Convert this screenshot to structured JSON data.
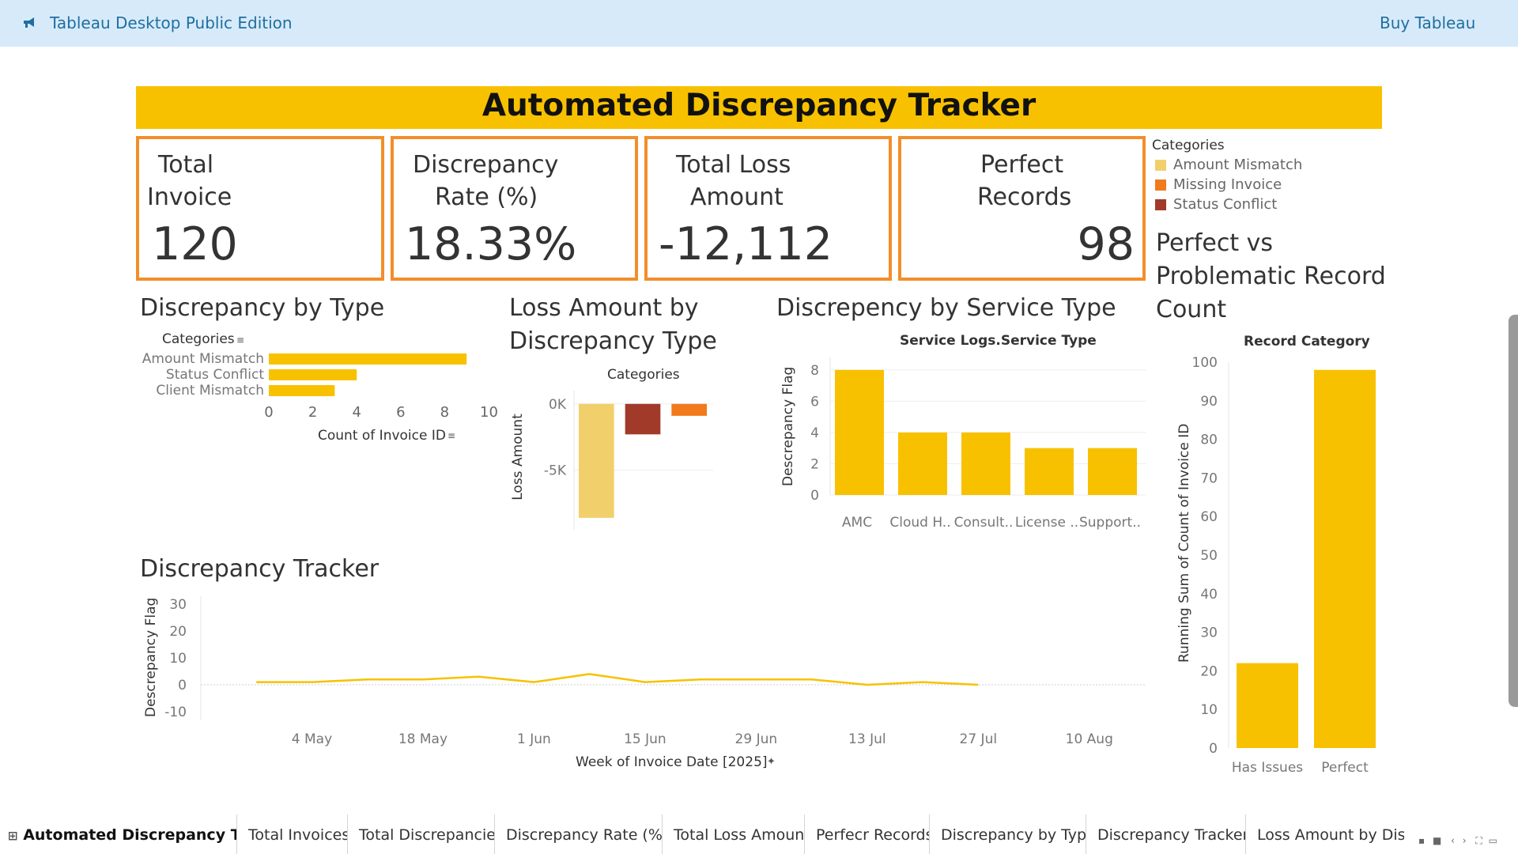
{
  "app": {
    "title": "Tableau Desktop Public Edition",
    "buy_label": "Buy Tableau"
  },
  "dashboard": {
    "title": "Automated Discrepancy Tracker",
    "accent_color": "#f8c100",
    "kpi_border_color": "#f28e2b"
  },
  "kpis": {
    "total_invoice": {
      "label_line1": "Total",
      "label_line2": "Invoice",
      "value": "120"
    },
    "discrepancy_rate": {
      "label_line1": "Discrepancy",
      "label_line2": "Rate (%)",
      "value": "18.33%"
    },
    "total_loss": {
      "label_line1": "Total Loss",
      "label_line2": "Amount",
      "value": "-12,112"
    },
    "perfect_records": {
      "label_line1": "Perfect",
      "label_line2": "Records",
      "value": "98"
    }
  },
  "legend": {
    "title": "Categories",
    "items": [
      {
        "label": "Amount Mismatch",
        "color": "#f1d06b"
      },
      {
        "label": "Missing Invoice",
        "color": "#f07a1c"
      },
      {
        "label": "Status Conflict",
        "color": "#a23a2a"
      }
    ]
  },
  "headings": {
    "by_type": "Discrepancy by Type",
    "loss_line1": "Loss Amount by",
    "loss_line2": "Discrepancy Type",
    "service": "Discrepency by Service Type",
    "tracker": "Discrepancy Tracker",
    "perfect_line1": "Perfect vs",
    "perfect_line2": "Problematic Record",
    "perfect_line3": "Count"
  },
  "chart_data": [
    {
      "type": "bar",
      "orientation": "horizontal",
      "row_header": "Categories",
      "categories": [
        "Amount Mismatch",
        "Status Conflict",
        "Client Mismatch"
      ],
      "values": [
        9,
        4,
        3
      ],
      "xlabel": "Count of Invoice ID",
      "xlim": [
        0,
        10
      ],
      "xticks": [
        "0",
        "2",
        "4",
        "6",
        "8",
        "10"
      ],
      "color": "#f8c100"
    },
    {
      "type": "bar",
      "column_header": "Categories",
      "categories": [
        "Amo..",
        "Statu..",
        "Missi.."
      ],
      "values": [
        -8600,
        -2300,
        -900
      ],
      "colors": [
        "#f1d06b",
        "#a23a2a",
        "#f07a1c"
      ],
      "ylabel": "Loss Amount",
      "ylim": [
        -9500,
        1000
      ],
      "yticks": [
        {
          "v": 0,
          "label": "0K"
        },
        {
          "v": -5000,
          "label": "-5K"
        }
      ]
    },
    {
      "type": "bar",
      "column_header": "Service Logs.Service Type",
      "categories": [
        "AMC",
        "Cloud H..",
        "Consult..",
        "License ..",
        "Support.."
      ],
      "values": [
        8,
        4,
        4,
        3,
        3
      ],
      "ylabel": "Descrepancy Flag",
      "ylim": [
        0,
        8.8
      ],
      "yticks": [
        0,
        2,
        4,
        6,
        8
      ],
      "color": "#f8c100"
    },
    {
      "type": "line",
      "x": [
        "2025-04-27",
        "2025-05-04",
        "2025-05-11",
        "2025-05-18",
        "2025-05-25",
        "2025-06-01",
        "2025-06-08",
        "2025-06-15",
        "2025-06-22",
        "2025-06-29",
        "2025-07-06",
        "2025-07-13",
        "2025-07-20",
        "2025-07-27"
      ],
      "y": [
        1,
        1,
        2,
        2,
        3,
        1,
        4,
        1,
        2,
        2,
        2,
        0,
        1,
        0
      ],
      "xticks": [
        "4 May",
        "18 May",
        "1 Jun",
        "15 Jun",
        "29 Jun",
        "13 Jul",
        "27 Jul",
        "10 Aug"
      ],
      "xlabel": "Week of Invoice Date [2025]",
      "ylabel": "Descrepancy Flag",
      "ylim": [
        -10,
        30
      ],
      "yticks": [
        -10,
        0,
        10,
        20,
        30
      ],
      "color": "#f8c100"
    },
    {
      "type": "bar",
      "column_header": "Record Category",
      "categories": [
        "Has Issues",
        "Perfect"
      ],
      "values": [
        22,
        98
      ],
      "ylabel": "Running Sum of Count of Invoice ID",
      "ylim": [
        0,
        100
      ],
      "yticks": [
        0,
        10,
        20,
        30,
        40,
        50,
        60,
        70,
        80,
        90,
        100
      ],
      "color": "#f8c100"
    }
  ],
  "tabs": [
    {
      "label": "Automated Discrepancy Tra..."
    },
    {
      "label": "Total Invoices"
    },
    {
      "label": "Total Discrepancies"
    },
    {
      "label": "Discrepancy Rate (%)"
    },
    {
      "label": "Total Loss Amount"
    },
    {
      "label": "Perfecr Records"
    },
    {
      "label": "Discrepancy by Type"
    },
    {
      "label": "Discrepancy Tracker"
    },
    {
      "label": "Loss Amount by Discrep"
    }
  ]
}
